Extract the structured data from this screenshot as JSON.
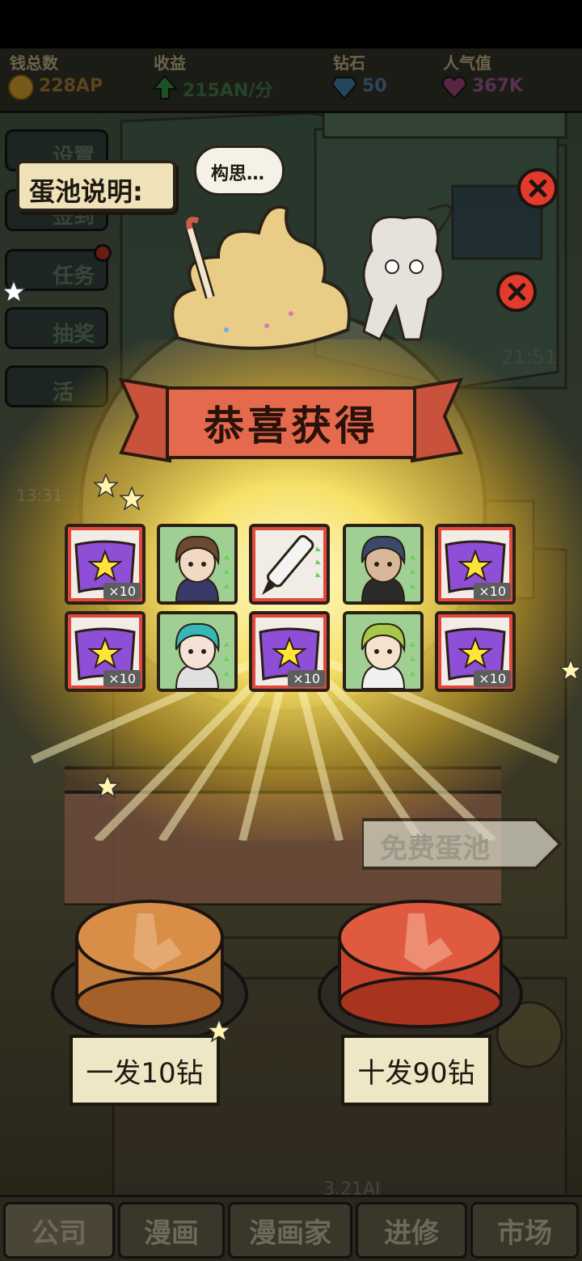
{
  "resources": {
    "money": {
      "label": "钱总数",
      "value": "228AP"
    },
    "income": {
      "label": "收益",
      "value": "215AN/分"
    },
    "diamond": {
      "label": "钻石",
      "value": "50"
    },
    "popularity": {
      "label": "人气值",
      "value": "367K"
    }
  },
  "side_menu": [
    {
      "label": "设置",
      "icon": "gear-icon"
    },
    {
      "label": "签到",
      "icon": "calendar-icon"
    },
    {
      "label": "任务",
      "icon": "clipboard-icon"
    },
    {
      "label": "抽奖",
      "icon": "lottery-icon"
    },
    {
      "label": "活",
      "icon": "gift-icon"
    }
  ],
  "pool_info_label": "蛋池说明:",
  "thought_bubble": "构思…",
  "dialog": {
    "title": "恭喜获得",
    "rewards": [
      {
        "type": "flag-item",
        "qty": "×10",
        "frame": "red"
      },
      {
        "type": "character",
        "name": "brown-hair-boy",
        "frame": "green"
      },
      {
        "type": "pen-item",
        "frame": "red"
      },
      {
        "type": "character",
        "name": "old-sage",
        "frame": "green"
      },
      {
        "type": "flag-item",
        "qty": "×10",
        "frame": "red"
      },
      {
        "type": "flag-item",
        "qty": "×10",
        "frame": "red"
      },
      {
        "type": "character",
        "name": "teal-hair-girl",
        "frame": "green"
      },
      {
        "type": "flag-item",
        "qty": "×10",
        "frame": "red"
      },
      {
        "type": "character",
        "name": "green-hair-boy",
        "frame": "green"
      },
      {
        "type": "flag-item",
        "qty": "×10",
        "frame": "red"
      }
    ]
  },
  "free_pool_label": "免费蛋池",
  "buttons": {
    "single": "一发10钻",
    "ten": "十发90钻"
  },
  "background_text": {
    "time1": "21:51",
    "time2": "13:31",
    "money_bottom": "3.21AI"
  },
  "bottom_nav": [
    {
      "label": "公司",
      "active": true
    },
    {
      "label": "漫画",
      "active": false
    },
    {
      "label": "漫画家",
      "active": false
    },
    {
      "label": "进修",
      "active": false
    },
    {
      "label": "市场",
      "active": false
    }
  ],
  "colors": {
    "banner": "#e56a4d",
    "close": "#e23a2b",
    "burst": "#ffe86a"
  }
}
